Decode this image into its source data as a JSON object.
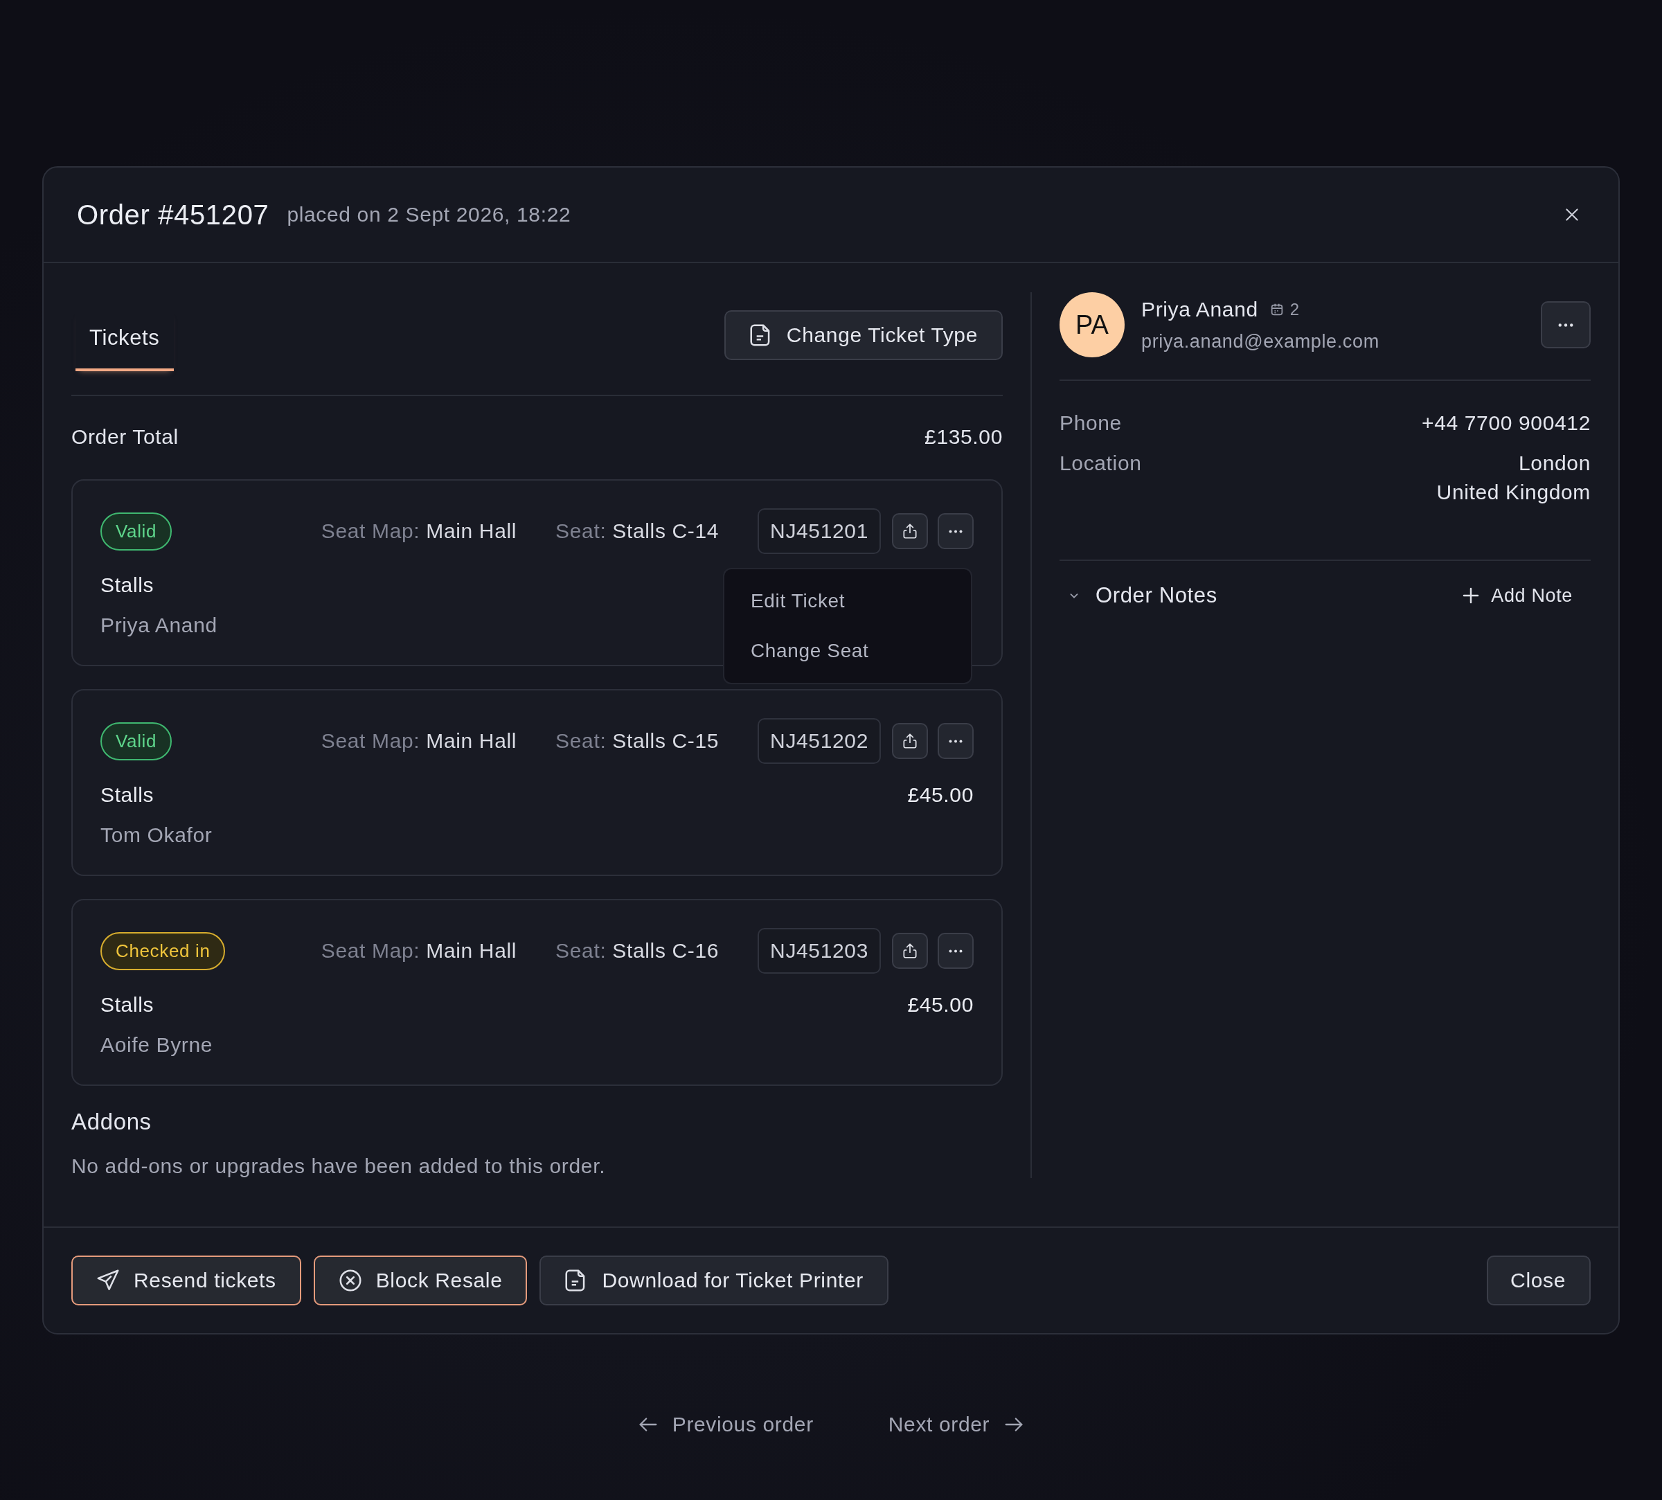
{
  "modal": {
    "title": "Order #451207",
    "subtitle": "placed on 2 Sept 2026, 18:22"
  },
  "tabs": [
    {
      "label": "Tickets",
      "selected": true
    }
  ],
  "change_ticket_type": "Change Ticket Type",
  "order_total": {
    "label": "Order Total",
    "value": "£135.00"
  },
  "tickets": [
    {
      "status": "Valid",
      "kind": "valid",
      "seat_map_label": "Seat Map:",
      "seat_map": "Main Hall",
      "seat_label": "Seat:",
      "seat": "Stalls C-14",
      "code": "NJ451201",
      "type": "Stalls",
      "holder": "Priya Anand",
      "menu": [
        "Edit Ticket",
        "Change Seat"
      ]
    },
    {
      "status": "Valid",
      "kind": "valid",
      "seat_map_label": "Seat Map:",
      "seat_map": "Main Hall",
      "seat_label": "Seat:",
      "seat": "Stalls C-15",
      "code": "NJ451202",
      "type": "Stalls",
      "holder": "Tom Okafor",
      "price": "£45.00"
    },
    {
      "status": "Checked in",
      "kind": "checked_in",
      "seat_map_label": "Seat Map:",
      "seat_map": "Main Hall",
      "seat_label": "Seat:",
      "seat": "Stalls C-16",
      "code": "NJ451203",
      "type": "Stalls",
      "holder": "Aoife Byrne",
      "price": "£45.00"
    }
  ],
  "addons": {
    "title": "Addons",
    "message": "No add-ons or upgrades have been added to this order."
  },
  "customer": {
    "initials": "PA",
    "name": "Priya Anand",
    "orders_count": "2",
    "email": "priya.anand@example.com"
  },
  "details": [
    {
      "label": "Phone",
      "lines": [
        "+44 7700 900412"
      ]
    },
    {
      "label": "Location",
      "lines": [
        "London",
        "United Kingdom"
      ]
    }
  ],
  "order_notes": {
    "title": "Order Notes",
    "add_label": "Add Note"
  },
  "footer": {
    "actions": [
      {
        "label": "Resend tickets",
        "kind": "send",
        "accent": true
      },
      {
        "label": "Block Resale",
        "kind": "block",
        "accent": true
      },
      {
        "label": "Download for Ticket Printer",
        "kind": "download",
        "accent": false
      }
    ],
    "close": "Close"
  },
  "navigation": {
    "previous": "Previous order",
    "next": "Next order"
  }
}
